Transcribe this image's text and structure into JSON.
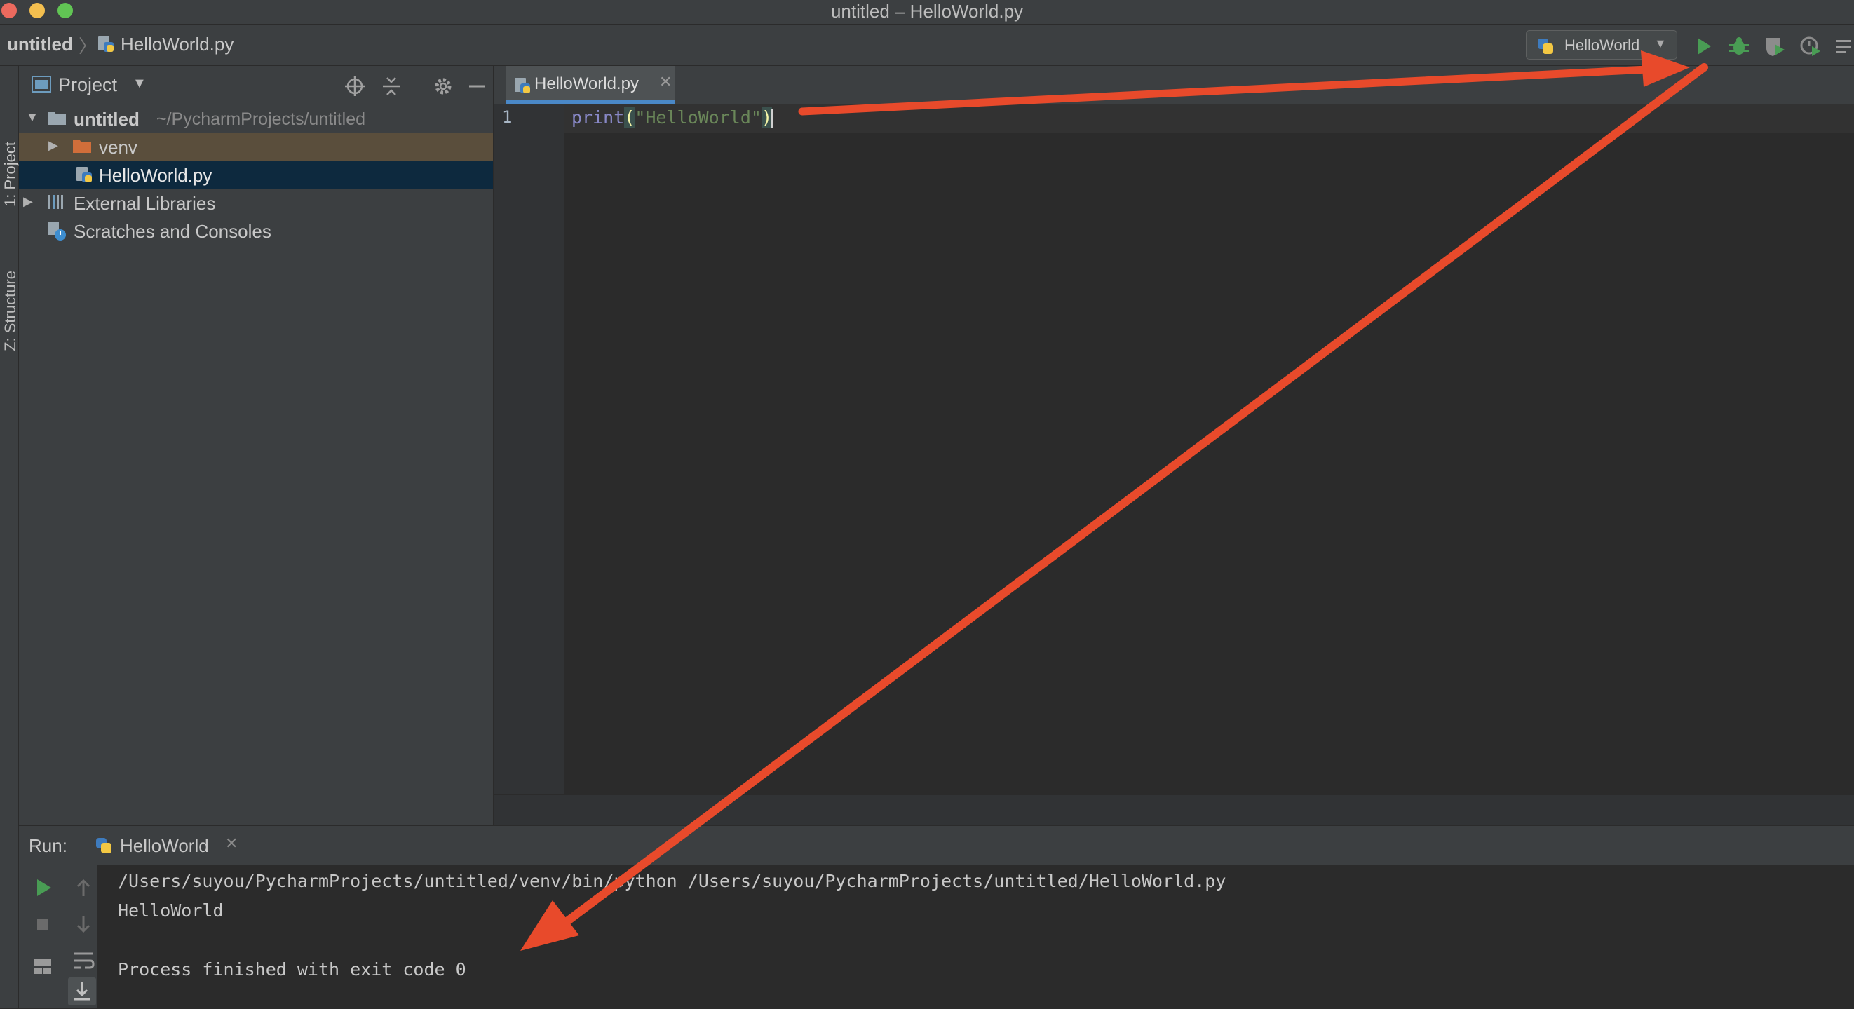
{
  "window": {
    "title": "untitled – HelloWorld.py"
  },
  "navbar": {
    "project": "untitled",
    "file": "HelloWorld.py",
    "run_config": "HelloWorld",
    "buttons": [
      "run-icon",
      "debug-icon",
      "coverage-icon",
      "profile-icon",
      "more-icon"
    ]
  },
  "left_strip": {
    "project_label": "1: Project",
    "structure_label": "Z: Structure"
  },
  "project_panel": {
    "title": "Project",
    "tree": [
      {
        "label": "untitled",
        "path": "~/PycharmProjects/untitled",
        "type": "folder",
        "expanded": true
      },
      {
        "label": "venv",
        "type": "excluded-folder",
        "expanded": false
      },
      {
        "label": "HelloWorld.py",
        "type": "python-file",
        "selected": true
      },
      {
        "label": "External Libraries",
        "type": "libraries",
        "expanded": false
      },
      {
        "label": "Scratches and Consoles",
        "type": "scratches"
      }
    ]
  },
  "editor": {
    "tab": "HelloWorld.py",
    "line_number": "1",
    "code": {
      "fn": "print",
      "open_paren": "(",
      "string": "\"HelloWorld\"",
      "close_paren": ")"
    }
  },
  "run_panel": {
    "label": "Run:",
    "tab": "HelloWorld",
    "console": [
      "/Users/suyou/PycharmProjects/untitled/venv/bin/python /Users/suyou/PycharmProjects/untitled/HelloWorld.py",
      "HelloWorld",
      "",
      "Process finished with exit code 0"
    ]
  },
  "colors": {
    "background": "#2b2b2b",
    "panel": "#3c3f41",
    "selection": "#0d293e",
    "run_green": "#499c54",
    "annotation_arrow": "#e84a2b",
    "tab_underline": "#4a88c7"
  }
}
